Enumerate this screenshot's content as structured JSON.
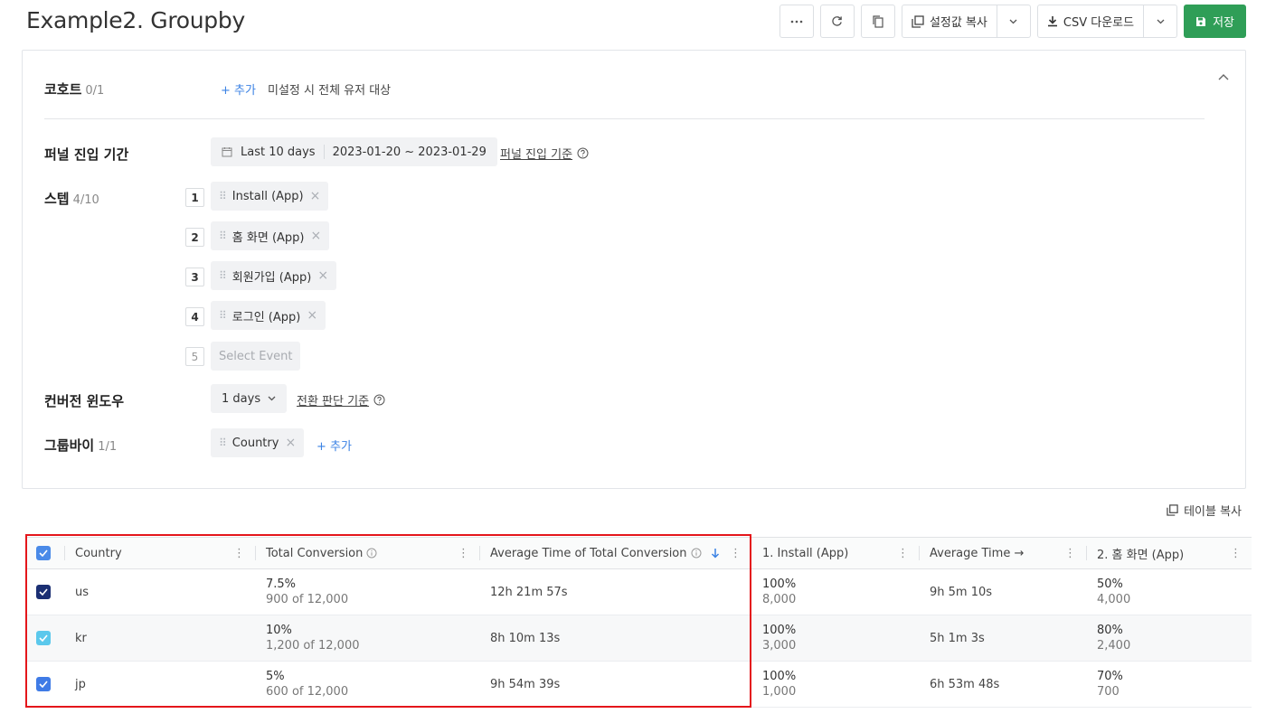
{
  "header": {
    "title": "Example2. Groupby",
    "toolbar": {
      "more_icon": "more-horizontal-icon",
      "refresh_icon": "refresh-icon",
      "duplicate_icon": "duplicate-icon",
      "copy_settings_label": "설정값 복사",
      "csv_download_label": "CSV 다운로드",
      "save_label": "저장"
    }
  },
  "config": {
    "cohort": {
      "label": "코호트",
      "count": "0/1",
      "add_label": "+ 추가",
      "hint": "미설정 시 전체 유저 대상"
    },
    "funnel_period": {
      "label": "퍼널 진입 기간",
      "preset": "Last 10 days",
      "range": "2023-01-20 ~ 2023-01-29",
      "criteria_link": "퍼널 진입 기준"
    },
    "steps": {
      "label": "스텝",
      "count": "4/10",
      "items": [
        {
          "num": "1",
          "name": "Install (App)"
        },
        {
          "num": "2",
          "name": "홈 화면 (App)"
        },
        {
          "num": "3",
          "name": "회원가입 (App)"
        },
        {
          "num": "4",
          "name": "로그인 (App)"
        }
      ],
      "next_num": "5",
      "placeholder": "Select Event"
    },
    "conversion_window": {
      "label": "컨버전 윈도우",
      "value": "1 days",
      "criteria_link": "전환 판단 기준"
    },
    "groupby": {
      "label": "그룹바이",
      "count": "1/1",
      "chip": "Country",
      "add_label": "+ 추가"
    }
  },
  "table_copy_label": "테이블 복사",
  "table": {
    "headers": {
      "country": "Country",
      "total_conversion": "Total Conversion",
      "avg_time_total": "Average Time of Total Conversion",
      "step1": "1. Install (App)",
      "avg_time": "Average Time →",
      "step2": "2. 홈 화면 (App)"
    },
    "rows": [
      {
        "country": "us",
        "checkbox_color": "#1b2f73",
        "total_pct": "7.5%",
        "total_of": "900 of 12,000",
        "avg_total": "12h 21m 57s",
        "step1_pct": "100%",
        "step1_count": "8,000",
        "avg_time": "9h 5m 10s",
        "step2_pct": "50%",
        "step2_count": "4,000"
      },
      {
        "country": "kr",
        "checkbox_color": "#5bc8ec",
        "total_pct": "10%",
        "total_of": "1,200 of 12,000",
        "avg_total": "8h 10m 13s",
        "step1_pct": "100%",
        "step1_count": "3,000",
        "avg_time": "5h 1m 3s",
        "step2_pct": "80%",
        "step2_count": "2,400"
      },
      {
        "country": "jp",
        "checkbox_color": "#3f7be6",
        "total_pct": "5%",
        "total_of": "600 of 12,000",
        "avg_total": "9h 54m 39s",
        "step1_pct": "100%",
        "step1_count": "1,000",
        "avg_time": "6h 53m 48s",
        "step2_pct": "70%",
        "step2_count": "700"
      }
    ]
  },
  "colors": {
    "save_green": "#2f9e57",
    "link_blue": "#3b82e4",
    "highlight_red": "#e4161b",
    "header_checkbox": "#4a8ae8"
  }
}
